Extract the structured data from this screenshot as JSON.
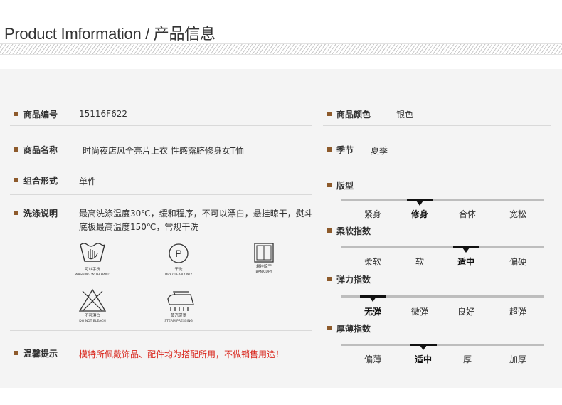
{
  "header": {
    "title": "Product Imformation / 产品信息"
  },
  "left": {
    "product_no": {
      "label": "商品编号",
      "value": "15116F622"
    },
    "product_name": {
      "label": "商品名称",
      "value": "时尚夜店风全亮片上衣 性感露脐修身女T恤"
    },
    "combination": {
      "label": "组合形式",
      "value": "单件"
    },
    "washing": {
      "label": "洗涤说明",
      "value": "最高洗涤温度30℃，缓和程序，不可以漂白，悬挂晾干，熨斗底板最高温度150℃，常规干洗"
    },
    "care_icons": [
      {
        "icon": "hand-wash-icon",
        "cn": "可以手洗",
        "en": "WASHING WITH HAND"
      },
      {
        "icon": "dry-clean-icon",
        "cn": "干洗",
        "en": "DRY CLEAN ONLY",
        "glyph": "P"
      },
      {
        "icon": "hang-dry-icon",
        "cn": "悬挂晾干",
        "en": "BANK DRY"
      },
      {
        "icon": "no-bleach-icon",
        "cn": "不可漂白",
        "en": "DO NOT BLEACH"
      },
      {
        "icon": "steam-iron-icon",
        "cn": "蒸汽熨烫",
        "en": "STEAM PRESSING"
      }
    ],
    "tips": {
      "label": "温馨提示",
      "value": "模特所佩戴饰品、配件均为搭配所用，不做销售用途！"
    }
  },
  "right": {
    "color": {
      "label": "商品颜色",
      "value": "银色"
    },
    "season": {
      "label": "季节",
      "value": "夏季"
    },
    "scales": [
      {
        "label": "版型",
        "options": [
          "紧身",
          "修身",
          "合体",
          "宽松"
        ],
        "selected": 1
      },
      {
        "label": "柔软指数",
        "options": [
          "柔软",
          "软",
          "适中",
          "偏硬"
        ],
        "selected": 2
      },
      {
        "label": "弹力指数",
        "options": [
          "无弹",
          "微弹",
          "良好",
          "超弹"
        ],
        "selected": 0
      },
      {
        "label": "厚薄指数",
        "options": [
          "偏薄",
          "适中",
          "厚",
          "加厚"
        ],
        "selected": 1
      }
    ]
  },
  "colors": {
    "bullet": "#8d5a2b",
    "accent_red": "#d9261c",
    "panel_bg": "#f4f4f4",
    "scale_line": "#bdbdbd"
  }
}
